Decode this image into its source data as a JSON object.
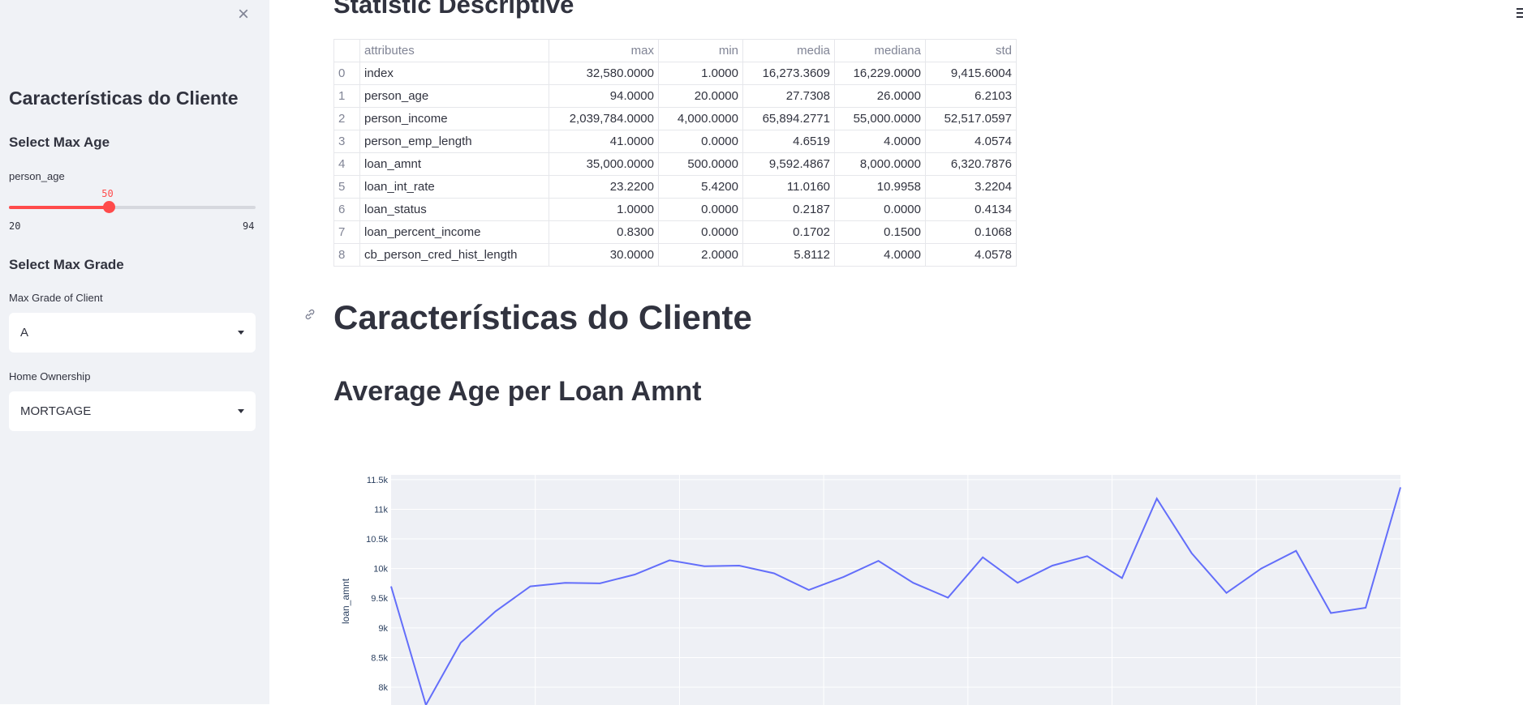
{
  "sidebar": {
    "title": "Características do Cliente",
    "age_section": "Select Max Age",
    "age_label": "person_age",
    "age_value": "50",
    "age_min": "20",
    "age_max": "94",
    "grade_section": "Select Max Grade",
    "grade_label": "Max Grade of Client",
    "grade_value": "A",
    "home_label": "Home Ownership",
    "home_value": "MORTGAGE"
  },
  "main": {
    "stat_title": "Statistic Descriptive",
    "table": {
      "headers": [
        "",
        "attributes",
        "max",
        "min",
        "media",
        "mediana",
        "std"
      ],
      "rows": [
        [
          "0",
          "index",
          "32,580.0000",
          "1.0000",
          "16,273.3609",
          "16,229.0000",
          "9,415.6004"
        ],
        [
          "1",
          "person_age",
          "94.0000",
          "20.0000",
          "27.7308",
          "26.0000",
          "6.2103"
        ],
        [
          "2",
          "person_income",
          "2,039,784.0000",
          "4,000.0000",
          "65,894.2771",
          "55,000.0000",
          "52,517.0597"
        ],
        [
          "3",
          "person_emp_length",
          "41.0000",
          "0.0000",
          "4.6519",
          "4.0000",
          "4.0574"
        ],
        [
          "4",
          "loan_amnt",
          "35,000.0000",
          "500.0000",
          "9,592.4867",
          "8,000.0000",
          "6,320.7876"
        ],
        [
          "5",
          "loan_int_rate",
          "23.2200",
          "5.4200",
          "11.0160",
          "10.9958",
          "3.2204"
        ],
        [
          "6",
          "loan_status",
          "1.0000",
          "0.0000",
          "0.2187",
          "0.0000",
          "0.4134"
        ],
        [
          "7",
          "loan_percent_income",
          "0.8300",
          "0.0000",
          "0.1702",
          "0.1500",
          "0.1068"
        ],
        [
          "8",
          "cb_person_cred_hist_length",
          "30.0000",
          "2.0000",
          "5.8112",
          "4.0000",
          "4.0578"
        ]
      ]
    },
    "section_title": "Características do Cliente",
    "chart_title": "Average Age per Loan Amnt"
  },
  "colors": {
    "accent": "#ff4b4b",
    "line": "#636efa",
    "plot_bg": "#e5ecf6"
  },
  "chart_data": {
    "type": "line",
    "title": "",
    "xlabel": "",
    "ylabel": "loan_amnt",
    "y_ticks": [
      "8k",
      "8.5k",
      "9k",
      "9.5k",
      "10k",
      "10.5k",
      "11k",
      "11.5k"
    ],
    "y_tick_values": [
      8000,
      8500,
      9000,
      9500,
      10000,
      10500,
      11000,
      11500
    ],
    "grid": true,
    "series": [
      {
        "values": [
          9700,
          7700,
          8750,
          9280,
          9700,
          9760,
          9750,
          9900,
          10140,
          10040,
          10050,
          9920,
          9640,
          9860,
          10130,
          9760,
          9510,
          10190,
          9760,
          10050,
          10210,
          9840,
          11180,
          10260,
          9590,
          10000,
          10300,
          9250,
          9340,
          11370
        ]
      }
    ]
  }
}
